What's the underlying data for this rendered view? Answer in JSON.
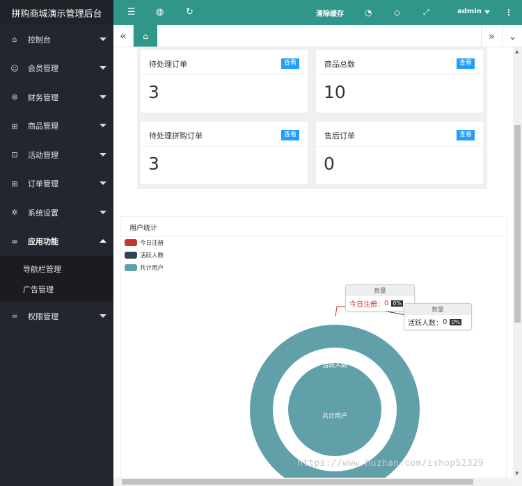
{
  "app": {
    "title": "拼购商城演示管理后台"
  },
  "sidebar": {
    "items": [
      {
        "label": "控制台",
        "icon": "home-icon"
      },
      {
        "label": "会员管理",
        "icon": "user-icon"
      },
      {
        "label": "财务管理",
        "icon": "finance-icon"
      },
      {
        "label": "商品管理",
        "icon": "goods-icon"
      },
      {
        "label": "活动管理",
        "icon": "gift-icon"
      },
      {
        "label": "订单管理",
        "icon": "order-icon"
      },
      {
        "label": "系统设置",
        "icon": "gear-icon"
      },
      {
        "label": "应用功能",
        "icon": "link-icon"
      },
      {
        "label": "权限管理",
        "icon": "link-icon"
      }
    ],
    "subitems": [
      {
        "label": "导航栏管理"
      },
      {
        "label": "广告管理"
      }
    ]
  },
  "header": {
    "clear_cache": "清除缓存",
    "user": "admin"
  },
  "cards": [
    {
      "title": "待处理订单",
      "badge": "查看",
      "value": "3"
    },
    {
      "title": "商品总数",
      "badge": "查看",
      "value": "10"
    },
    {
      "title": "待处理拼购订单",
      "badge": "查看",
      "value": "3"
    },
    {
      "title": "售后订单",
      "badge": "查看",
      "value": "0"
    }
  ],
  "stats": {
    "title": "用户统计",
    "legend": [
      {
        "name": "今日注册",
        "color": "#c23531"
      },
      {
        "name": "活跃人数",
        "color": "#2f4554"
      },
      {
        "name": "共计用户",
        "color": "#61a0a8"
      }
    ],
    "tooltip1": {
      "header": "数量",
      "label": "今日注册：",
      "value": "0",
      "pct": "0%"
    },
    "tooltip2": {
      "header": "数量",
      "label": "活跃人数：",
      "value": "0",
      "pct": "0%"
    },
    "inner_label_1": "今日注册",
    "inner_label_2": "活跃人数",
    "inner_label_3": "共计用户"
  },
  "chart_data": {
    "type": "pie",
    "title": "用户统计",
    "categories": [
      "今日注册",
      "活跃人数",
      "共计用户"
    ],
    "series": [
      {
        "name": "数量",
        "values": [
          0,
          0,
          1
        ]
      }
    ],
    "legend_position": "top-left"
  },
  "watermark": "https://www.huzhan.com/ishop52329"
}
